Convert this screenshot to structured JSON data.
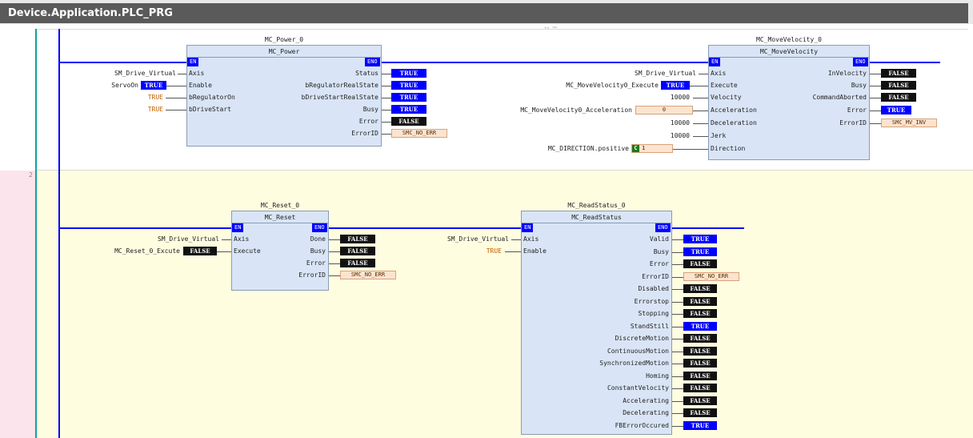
{
  "tab_title": "Device.Application.PLC_PRG",
  "grip": "-- ~",
  "network2_number": "2",
  "mc_power": {
    "instance": "MC_Power_0",
    "type": "MC_Power",
    "en": "EN",
    "eno": "ENO",
    "inputs": [
      {
        "pin": "Axis",
        "var": "SM_Drive_Virtual",
        "value": ""
      },
      {
        "pin": "Enable",
        "var": "ServoOn",
        "value": "TRUE"
      },
      {
        "pin": "bRegulatorOn",
        "var": "",
        "value": "TRUE"
      },
      {
        "pin": "bDriveStart",
        "var": "",
        "value": "TRUE"
      }
    ],
    "outputs": [
      {
        "pin": "Status",
        "value": "TRUE"
      },
      {
        "pin": "bRegulatorRealState",
        "value": "TRUE"
      },
      {
        "pin": "bDriveStartRealState",
        "value": "TRUE"
      },
      {
        "pin": "Busy",
        "value": "TRUE"
      },
      {
        "pin": "Error",
        "value": "FALSE"
      },
      {
        "pin": "ErrorID",
        "value": "SMC_NO_ERR"
      }
    ]
  },
  "mc_move": {
    "instance": "MC_MoveVelocity_0",
    "type": "MC_MoveVelocity",
    "en": "EN",
    "eno": "ENO",
    "inputs": [
      {
        "pin": "Axis",
        "var": "SM_Drive_Virtual",
        "value": ""
      },
      {
        "pin": "Execute",
        "var": "MC_MoveVelocity0_Execute",
        "value": "TRUE"
      },
      {
        "pin": "Velocity",
        "var": "10000",
        "value": ""
      },
      {
        "pin": "Acceleration",
        "var": "MC_MoveVelocity0_Acceleration",
        "value": "0"
      },
      {
        "pin": "Deceleration",
        "var": "10000",
        "value": ""
      },
      {
        "pin": "Jerk",
        "var": "10000",
        "value": ""
      },
      {
        "pin": "Direction",
        "var": "MC_DIRECTION.positive",
        "value": "1"
      }
    ],
    "outputs": [
      {
        "pin": "InVelocity",
        "value": "FALSE"
      },
      {
        "pin": "Busy",
        "value": "FALSE"
      },
      {
        "pin": "CommandAborted",
        "value": "FALSE"
      },
      {
        "pin": "Error",
        "value": "TRUE"
      },
      {
        "pin": "ErrorID",
        "value": "SMC_MV_INV"
      }
    ],
    "direction_badge": "C"
  },
  "mc_reset": {
    "instance": "MC_Reset_0",
    "type": "MC_Reset",
    "en": "EN",
    "eno": "ENO",
    "inputs": [
      {
        "pin": "Axis",
        "var": "SM_Drive_Virtual",
        "value": ""
      },
      {
        "pin": "Execute",
        "var": "MC_Reset_0_Excute",
        "value": "FALSE"
      }
    ],
    "outputs": [
      {
        "pin": "Done",
        "value": "FALSE"
      },
      {
        "pin": "Busy",
        "value": "FALSE"
      },
      {
        "pin": "Error",
        "value": "FALSE"
      },
      {
        "pin": "ErrorID",
        "value": "SMC_NO_ERR"
      }
    ]
  },
  "mc_status": {
    "instance": "MC_ReadStatus_0",
    "type": "MC_ReadStatus",
    "en": "EN",
    "eno": "ENO",
    "inputs": [
      {
        "pin": "Axis",
        "var": "SM_Drive_Virtual",
        "value": ""
      },
      {
        "pin": "Enable",
        "var": "TRUE",
        "value": ""
      }
    ],
    "outputs": [
      {
        "pin": "Valid",
        "value": "TRUE"
      },
      {
        "pin": "Busy",
        "value": "TRUE"
      },
      {
        "pin": "Error",
        "value": "FALSE"
      },
      {
        "pin": "ErrorID",
        "value": "SMC_NO_ERR"
      },
      {
        "pin": "Disabled",
        "value": "FALSE"
      },
      {
        "pin": "Errorstop",
        "value": "FALSE"
      },
      {
        "pin": "Stopping",
        "value": "FALSE"
      },
      {
        "pin": "StandStill",
        "value": "TRUE"
      },
      {
        "pin": "DiscreteMotion",
        "value": "FALSE"
      },
      {
        "pin": "ContinuousMotion",
        "value": "FALSE"
      },
      {
        "pin": "SynchronizedMotion",
        "value": "FALSE"
      },
      {
        "pin": "Homing",
        "value": "FALSE"
      },
      {
        "pin": "ConstantVelocity",
        "value": "FALSE"
      },
      {
        "pin": "Accelerating",
        "value": "FALSE"
      },
      {
        "pin": "Decelerating",
        "value": "FALSE"
      },
      {
        "pin": "FBErrorOccured",
        "value": "TRUE"
      }
    ]
  }
}
